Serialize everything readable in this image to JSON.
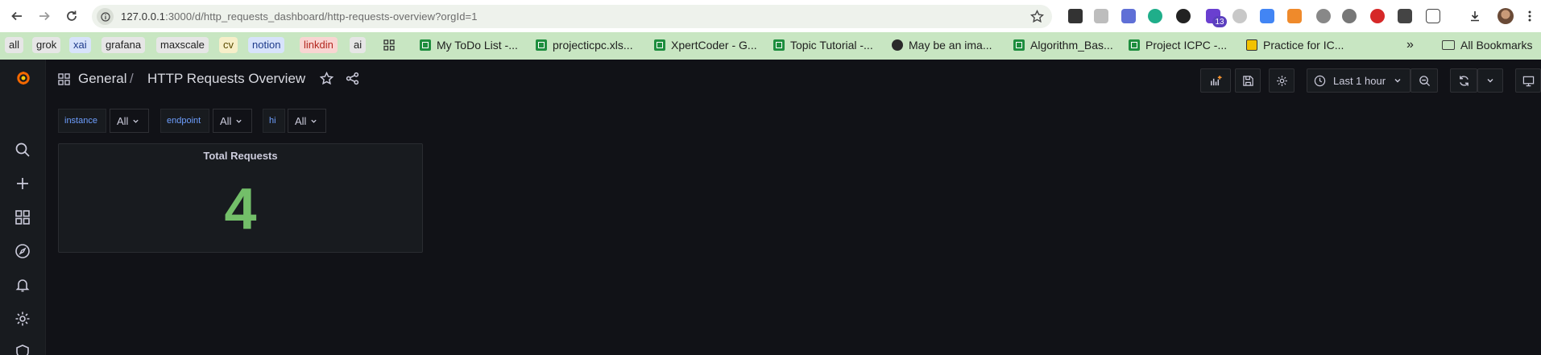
{
  "browser": {
    "url_host": "127.0.0.1",
    "url_rest": ":3000/d/http_requests_dashboard/http-requests-overview?orgId=1",
    "extension_badge": "13",
    "bookmark_chips": [
      {
        "label": "all",
        "bg": "#e6e6e6",
        "fg": "#222222"
      },
      {
        "label": "grok",
        "bg": "#e6e6e6",
        "fg": "#222222"
      },
      {
        "label": "xai",
        "bg": "#d7e3fb",
        "fg": "#1d3a8a"
      },
      {
        "label": "grafana",
        "bg": "#e6e6e6",
        "fg": "#222222"
      },
      {
        "label": "maxscale",
        "bg": "#e6e6e6",
        "fg": "#222222"
      },
      {
        "label": "cv",
        "bg": "#f7efc9",
        "fg": "#5a4a00"
      },
      {
        "label": "notion",
        "bg": "#d7e3fb",
        "fg": "#1d3a8a"
      },
      {
        "label": "linkdin",
        "bg": "#f9d5d2",
        "fg": "#b3261e"
      },
      {
        "label": "ai",
        "bg": "#e6e6e6",
        "fg": "#222222"
      }
    ],
    "bookmarks": [
      {
        "label": "My ToDo List -...",
        "icon": "sheet-icon"
      },
      {
        "label": "projecticpc.xls...",
        "icon": "sheet-icon"
      },
      {
        "label": "XpertCoder - G...",
        "icon": "sheet-icon"
      },
      {
        "label": "Topic Tutorial -...",
        "icon": "sheet-icon"
      },
      {
        "label": "May be an ima...",
        "icon": "globe-icon"
      },
      {
        "label": "Algorithm_Bas...",
        "icon": "sheet-icon"
      },
      {
        "label": "Project ICPC -...",
        "icon": "sheet-icon"
      },
      {
        "label": "Practice for IC...",
        "icon": "note-icon"
      }
    ],
    "overflow": "»",
    "all_bookmarks": "All Bookmarks"
  },
  "grafana": {
    "breadcrumb_folder": "General",
    "breadcrumb_separator": "/",
    "dashboard_title": "HTTP Requests Overview",
    "time_range": "Last 1 hour",
    "variables": [
      {
        "label": "instance",
        "value": "All"
      },
      {
        "label": "endpoint",
        "value": "All"
      },
      {
        "label": "hi",
        "value": "All"
      }
    ],
    "panel": {
      "title": "Total Requests",
      "value": "4",
      "value_color": "#73bf69"
    }
  }
}
